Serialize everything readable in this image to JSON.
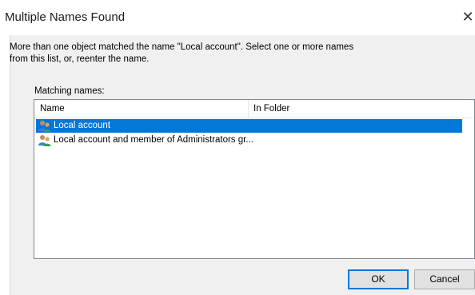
{
  "dialog": {
    "title": "Multiple Names Found",
    "close_glyph": "✕",
    "message": "More than one object matched the name \"Local account\". Select one or more names from this list, or, reenter the name.",
    "matching_label": "Matching names:"
  },
  "list": {
    "columns": [
      "Name",
      "In Folder"
    ],
    "rows": [
      {
        "name": "Local account",
        "folder": "",
        "selected": true,
        "icon": "user-group-icon"
      },
      {
        "name": "Local account and member of Administrators gr...",
        "folder": "",
        "selected": false,
        "icon": "user-group-icon"
      }
    ]
  },
  "buttons": {
    "ok": "OK",
    "cancel": "Cancel"
  },
  "colors": {
    "selection": "#0078d7",
    "content_bg": "#f0f0f0"
  }
}
